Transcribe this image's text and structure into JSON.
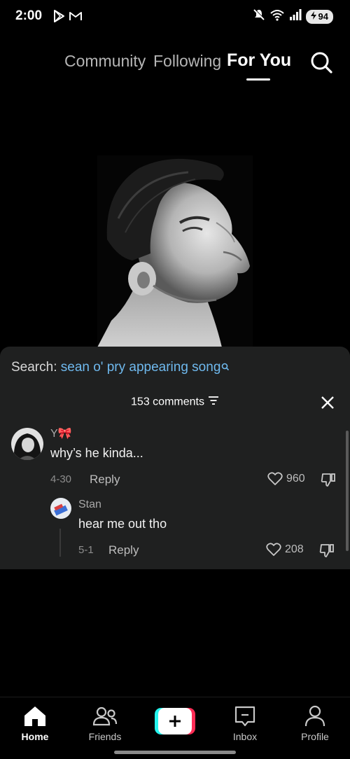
{
  "status_bar": {
    "time": "2:00",
    "battery": "94",
    "left_icons": [
      "play-store-icon",
      "gmail-icon"
    ],
    "right_icons": [
      "mute-icon",
      "wifi-icon",
      "signal-icon",
      "battery-icon"
    ]
  },
  "top_nav": {
    "tabs": [
      {
        "label": "Community"
      },
      {
        "label": "Following"
      },
      {
        "label": "For You"
      }
    ],
    "active_tab": "For You"
  },
  "comments_panel": {
    "search_prefix": "Search:",
    "search_query": "sean o' pry appearing song",
    "comment_count_label": "153 comments",
    "comments": [
      {
        "username": "Y",
        "username_emoji": "🎀",
        "text": "why’s he kinda...",
        "date": "4-30",
        "reply_label": "Reply",
        "likes": "960"
      },
      {
        "username": "Stan",
        "text": "hear me out tho",
        "date": "5-1",
        "reply_label": "Reply",
        "likes": "208"
      }
    ]
  },
  "bottom_nav": {
    "items": [
      {
        "label": "Home",
        "icon": "home-icon",
        "active": true
      },
      {
        "label": "Friends",
        "icon": "friends-icon",
        "active": false
      },
      {
        "label": "",
        "icon": "plus-icon",
        "active": false
      },
      {
        "label": "Inbox",
        "icon": "inbox-icon",
        "active": false
      },
      {
        "label": "Profile",
        "icon": "profile-icon",
        "active": false
      }
    ]
  },
  "colors": {
    "accent_link": "#6fb9ee",
    "sheet_bg": "#1f2020",
    "tiktok_cyan": "#25f4ee",
    "tiktok_red": "#fe2c55"
  }
}
